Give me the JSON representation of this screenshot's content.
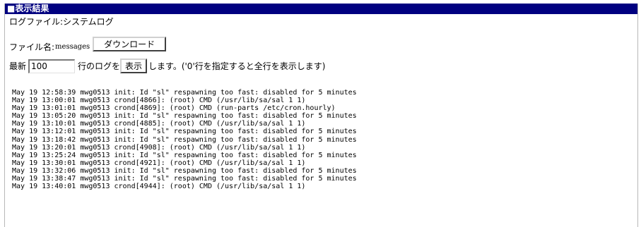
{
  "header": {
    "title": "■表示結果"
  },
  "logfile": {
    "label": "ログファイル:システムログ"
  },
  "filename": {
    "label": "ファイル名:",
    "value": "messages",
    "download_button": "ダウンロード"
  },
  "latest": {
    "prefix": "最新",
    "lines_value": "100",
    "suffix": "行のログを",
    "show_button": "表示",
    "note": "します。('0'行を指定すると全行を表示します)"
  },
  "log": {
    "lines": [
      "May 19 12:58:39 mwg0513 init: Id \"sl\" respawning too fast: disabled for 5 minutes",
      "May 19 13:00:01 mwg0513 crond[4866]: (root) CMD (/usr/lib/sa/sal 1 1)",
      "May 19 13:01:01 mwg0513 crond[4869]: (root) CMD (run-parts /etc/cron.hourly)",
      "May 19 13:05:20 mwg0513 init: Id \"sl\" respawning too fast: disabled for 5 minutes",
      "May 19 13:10:01 mwg0513 crond[4885]: (root) CMD (/usr/lib/sa/sal 1 1)",
      "May 19 13:12:01 mwg0513 init: Id \"sl\" respawning too fast: disabled for 5 minutes",
      "May 19 13:18:42 mwg0513 init: Id \"sl\" respawning too fast: disabled for 5 minutes",
      "May 19 13:20:01 mwg0513 crond[4908]: (root) CMD (/usr/lib/sa/sal 1 1)",
      "May 19 13:25:24 mwg0513 init: Id \"sl\" respawning too fast: disabled for 5 minutes",
      "May 19 13:30:01 mwg0513 crond[4921]: (root) CMD (/usr/lib/sa/sal 1 1)",
      "May 19 13:32:06 mwg0513 init: Id \"sl\" respawning too fast: disabled for 5 minutes",
      "May 19 13:38:47 mwg0513 init: Id \"sl\" respawning too fast: disabled for 5 minutes",
      "May 19 13:40:01 mwg0513 crond[4944]: (root) CMD (/usr/lib/sa/sal 1 1)"
    ]
  },
  "colors": {
    "header_background": "#000080",
    "header_text": "#ffffff"
  }
}
